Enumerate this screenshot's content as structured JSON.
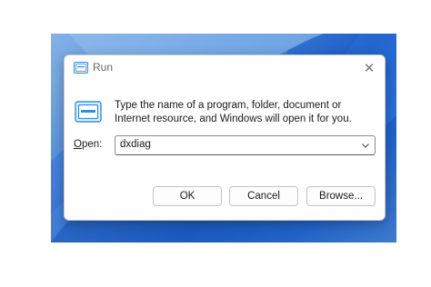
{
  "window": {
    "title": "Run",
    "close_glyph": "✕"
  },
  "dialog": {
    "description": "Type the name of a program, folder, document or Internet resource, and Windows will open it for you.",
    "open_label_accel": "O",
    "open_label_rest": "pen:",
    "open_value": "dxdiag"
  },
  "buttons": {
    "ok": "OK",
    "cancel": "Cancel",
    "browse": "Browse..."
  },
  "icons": {
    "title": "run-icon",
    "main": "run-icon",
    "close": "close-icon",
    "dropdown": "chevron-down-icon"
  },
  "colors": {
    "wallpaper_primary": "#1d5fc7",
    "dialog_bg": "#ffffff",
    "icon_accent": "#2f8fd8"
  }
}
